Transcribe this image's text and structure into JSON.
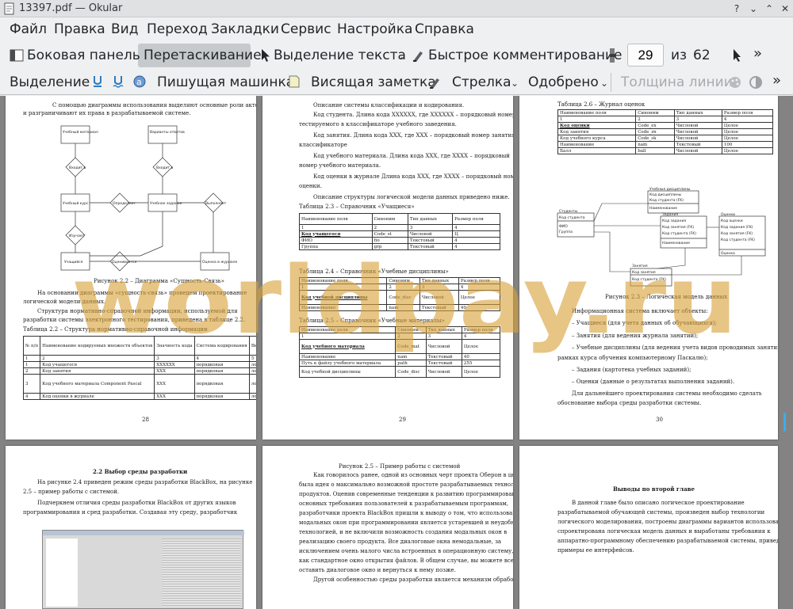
{
  "window": {
    "title": "13397.pdf  — Okular"
  },
  "menu": [
    "Файл",
    "Правка",
    "Вид",
    "Переход",
    "Закладки",
    "Сервис",
    "Настройка",
    "Справка"
  ],
  "toolbar1": {
    "sidebar": "Боковая панель",
    "drag": "Перетаскивание",
    "text_select": "Выделение текста",
    "quick_comment": "Быстрое комментирование",
    "page_current": "29",
    "page_of": "из",
    "page_total": "62"
  },
  "toolbar2": {
    "highlight": "Выделение",
    "typewriter": "Пишущая машинка",
    "note": "Висящая заметка",
    "arrow": "Стрелка",
    "stamp": "Одобрено",
    "line_width": "Толщина линии"
  },
  "watermark": "worldpay.ru",
  "doc": {
    "p28": {
      "intro1": "С помощью диаграммы использования выделяют основные роли акторов",
      "intro2": "и разграничивают их права в разрабатываемой системе.",
      "fig_caption": "Рисунок 2.2 – Диаграмма «Сущность-Связь»",
      "t1": "На основании диаграммы «сущность-связь» проведем проектирование",
      "t2": "логической модели данных.",
      "t3": "Структура нормативно-справочной информации, используемой для",
      "t4": "разработки системы электронного тестирования, приведена в таблице 2.2.",
      "table_caption": "Таблица 2.2 – Структура нормативно-справочной информации",
      "table": {
        "header": [
          "№ п/п",
          "Наименование кодируемых множеств объектов",
          "Значность кода",
          "Система кодирования",
          "Вид классификатора"
        ],
        "nums": [
          "1",
          "2",
          "3",
          "4",
          "5"
        ],
        "rows": [
          [
            "1",
            "Код учащегося",
            "XXXXXX",
            "порядковая",
            "локальный"
          ],
          [
            "2",
            "Код занятия",
            "XXX",
            "порядковая",
            "локальный"
          ],
          [
            "3",
            "Код учебного материала Component Pascal",
            "XXX",
            "порядковая",
            "локальный"
          ],
          [
            "4",
            "Код оценки в журнале",
            "XXX",
            "порядковая",
            "локальный"
          ]
        ]
      },
      "page_number": "28",
      "diagram": {
        "student": "Учебный материал",
        "variants": "Варианты ответов",
        "includes1": "Входит в",
        "includes2": "Входит в",
        "course": "Учебный курс",
        "defines": "Определяет",
        "tasks": "Учебное задание",
        "performs": "Выполняет",
        "studies": "Изучает",
        "learner": "Учащийся",
        "gets": "Оценивается",
        "grade": "Оценка в журнале"
      }
    },
    "p29": {
      "l1": "Описание системы классификации и кодирования.",
      "l2": "Код студента. Длина кода XXXXXX, где XXXXXX – порядковый номер",
      "l3": "тестируемого в классификаторе учебного заведения.",
      "l4": "Код занятия. Длина кода XXX, где XXX – порядковый номер занятия в",
      "l5": "классификаторе",
      "l6": "Код учебного материала. Длина кода XXX, где XXXX – порядковый",
      "l7": "номер учебного материала.",
      "l8": "Код оценки в журнале Длина кода XXX, где XXXX – порядковый номер",
      "l9": "оценки.",
      "l10": "Описание структуры логической модели данных приведено ниже.",
      "t23_caption": "Таблица 2.3 – Справочник «Учащиеся»",
      "t23": {
        "header": [
          "Наименование поля",
          "Синоним",
          "Тип данных",
          "Размер поля"
        ],
        "nums": [
          "1",
          "2",
          "3",
          "4"
        ],
        "rows": [
          [
            "Код учащегося",
            "Code_st",
            "Числовой",
            "Ц"
          ],
          [
            "ФИО",
            "fio",
            "Текстовый",
            "4"
          ],
          [
            "Группа",
            "grp",
            "Текстовый",
            "4"
          ]
        ]
      },
      "t24_caption": "Таблица 2.4 – Справочник «Учебные дисциплины»",
      "t24": {
        "header": [
          "Наименование поля",
          "Синоним",
          "Тип данных",
          "Размер поля"
        ],
        "nums": [
          "1",
          "2",
          "3",
          "4"
        ],
        "rows": [
          [
            "Код учебной дисциплины",
            "Code_disc",
            "Числовой",
            "Целое"
          ],
          [
            "Наименование",
            "nam",
            "Текстовый",
            "40"
          ]
        ]
      },
      "t25_caption": "Таблица 2.5 – Справочник «Учебные материалы»",
      "t25": {
        "header": [
          "Наименование поля",
          "Синоним",
          "Тип данных",
          "Размер поля"
        ],
        "nums": [
          "1",
          "2",
          "3",
          "4"
        ],
        "rows": [
          [
            "Код учебного материала",
            "Code_mat",
            "Числовой",
            "Целое"
          ],
          [
            "Наименование",
            "nam",
            "Текстовый",
            "40"
          ],
          [
            "Путь к файлу учебного материала",
            "path",
            "Текстовый",
            "255"
          ],
          [
            "Код учебной дисциплины",
            "Code_disc",
            "Числовой",
            "Целое"
          ]
        ]
      },
      "page_number": "29"
    },
    "p30": {
      "t26_caption": "Таблица 2.6 – Журнал оценок",
      "t26": {
        "header": [
          "Наименование поля",
          "Синоним",
          "Тип данных",
          "Размер поля"
        ],
        "nums": [
          "1",
          "2",
          "3",
          "4"
        ],
        "rows": [
          [
            "Код оценки",
            "Code_ex",
            "Числовой",
            "Целое"
          ],
          [
            "Код занятия",
            "Code_zn",
            "Числовой",
            "Целое"
          ],
          [
            "Код учебного курса",
            "Code_sk",
            "Числовой",
            "Целое"
          ],
          [
            "Наименование",
            "nam",
            "Текстовый",
            "100"
          ],
          [
            "Балл",
            "ball",
            "Числовой",
            "Целое"
          ]
        ]
      },
      "fig_caption": "Рисунок 2.3 – Логическая модель данных",
      "l1": "Информационная система включает объекты:",
      "b1": "Учащиеся (для учета данных об обучающихся);",
      "b2": "Занятия (для ведения журнала занятий);",
      "b3": "Учебные дисциплины (для ведения учета видов проводимых занятий в",
      "b3b": "рамках курса обучения компьютерному Паскалю);",
      "b4": "Задания (картотека учебных заданий);",
      "b5": "Оценки (данные о результатах выполнения заданий).",
      "l2": "Для дальнейшего проектирования системы необходимо сделать",
      "l3": "обоснование выбора среды разработки системы.",
      "page_number": "30",
      "model": {
        "disc_title": "Учебные дисциплины",
        "disc_f1": "Код дисциплины",
        "disc_f2": "Код студента (FK)",
        "disc_f3": "Наименование",
        "stud_title": "Студенты",
        "stud_f1": "Код студента",
        "stud_f2": "ФИО",
        "stud_f3": "Группа",
        "task_title": "Задания",
        "task_f1": "Код задания",
        "task_f2": "Код занятия (FK)",
        "task_f3": "Код студента (FK)",
        "task_f4": "Наименование",
        "grade_title": "Оценки",
        "grade_f1": "Код оценки",
        "grade_f2": "Код задания (FK)",
        "grade_f3": "Код занятия (FK)",
        "grade_f4": "Код студента (FK)",
        "grade_f5": "Оценка",
        "lesson_title": "Занятия",
        "lesson_f1": "Код занятия",
        "lesson_f2": "Код студента (FK)"
      }
    },
    "p31": {
      "heading": "2.2 Выбор среды разработки",
      "l1": "На рисунке 2.4 приведен режим среды разработки BlackBox, на рисунке",
      "l2": "2.5 – пример работы с системой.",
      "l3": "Подчеркнем отличия среды разработки BlackBox от других языков",
      "l4": "программирования и сред разработки. Создавая эту среду, разработчик"
    },
    "p32": {
      "caption": "Рисунок 2.5 – Пример работы с системой",
      "l1": "Как говорилось ранее, одной из основных черт проекта Оберон в целом",
      "l2": "была идея о максимально возможной простоте разрабатываемых технологий и",
      "l3": "продуктов. Оценив современные тенденции к развитию программирования в",
      "l4": "основных требования пользователей к разрабатываемым программам,",
      "l5": "разработчики проекта BlackBox пришли к выводу о том, что использование",
      "l6": "модальных окон при программировании является устаревшей и неудобной",
      "l7": "технологией, и не включили возможность создания модальных окон в",
      "l8": "реализацию своего продукта. Все диалоговые окна немодальные, за",
      "l9": "исключением очень малого числа встроенных в операционную систему, таких",
      "l10": "как стандартное окно открытия файлов. В общем случае, вы можете всегда",
      "l11": "оставить диалоговое окно и вернуться к нему позже.",
      "l12": "Другой особенностью среды разработки является механизм обработки"
    },
    "p33": {
      "heading": "Выводы по второй главе",
      "l1": "В данной главе было описано логическое проектирование",
      "l2": "разрабатываемой обучающей системы, произведен выбор технологии",
      "l3": "логического моделирования, построены диаграммы вариантов использования,",
      "l4": "спроектирована логическая модель данных и выработаны требования к",
      "l5": "аппаратно-программному обеспечению разрабатываемой системы, приведены",
      "l6": "примеры ее интерфейсов."
    }
  }
}
